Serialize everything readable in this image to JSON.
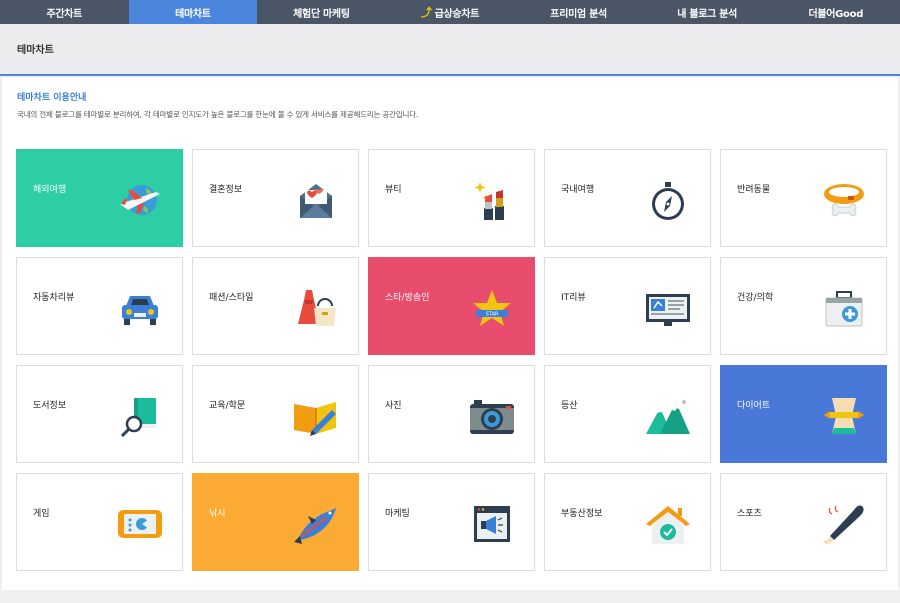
{
  "nav": {
    "tabs": [
      {
        "label": "주간차트"
      },
      {
        "label": "테마차트"
      },
      {
        "label": "체험단 마케팅"
      },
      {
        "label": "급상승차트"
      },
      {
        "label": "프리미엄 분석"
      },
      {
        "label": "내 블로그 분석"
      },
      {
        "label": "더블어Good"
      }
    ],
    "active_index": 1
  },
  "section": {
    "title": "테마차트"
  },
  "info": {
    "title": "테마차트 이용안내",
    "description": "국내의 전체 블로그를 테마별로 분리하여, 각 테마별로 인지도가 높은 블로그를 한눈에 볼 수 있게 서비스를 제공해드리는 공간입니다."
  },
  "themes": [
    {
      "label": "해외여행",
      "icon": "airplane-globe-icon",
      "highlight": "#2dcea6"
    },
    {
      "label": "결혼정보",
      "icon": "love-letter-icon"
    },
    {
      "label": "뷰티",
      "icon": "lipstick-icon"
    },
    {
      "label": "국내여행",
      "icon": "compass-icon"
    },
    {
      "label": "반려동물",
      "icon": "dog-collar-icon"
    },
    {
      "label": "자동차리뷰",
      "icon": "car-icon"
    },
    {
      "label": "패션/스타일",
      "icon": "dress-bag-icon"
    },
    {
      "label": "스타/방송인",
      "icon": "star-badge-icon",
      "highlight": "#e84d6e"
    },
    {
      "label": "IT리뷰",
      "icon": "monitor-icon"
    },
    {
      "label": "건강/의학",
      "icon": "medical-kit-icon"
    },
    {
      "label": "도서정보",
      "icon": "book-magnifier-icon"
    },
    {
      "label": "교육/학문",
      "icon": "book-pencil-icon"
    },
    {
      "label": "사진",
      "icon": "camera-icon"
    },
    {
      "label": "등산",
      "icon": "mountain-icon"
    },
    {
      "label": "다이어트",
      "icon": "waist-measure-icon",
      "highlight": "#4a78d8"
    },
    {
      "label": "게임",
      "icon": "game-console-icon"
    },
    {
      "label": "낚시",
      "icon": "fish-icon",
      "highlight": "#fbaa33"
    },
    {
      "label": "마케팅",
      "icon": "megaphone-window-icon"
    },
    {
      "label": "부동산정보",
      "icon": "house-check-icon"
    },
    {
      "label": "스포츠",
      "icon": "baseball-bat-icon"
    }
  ]
}
